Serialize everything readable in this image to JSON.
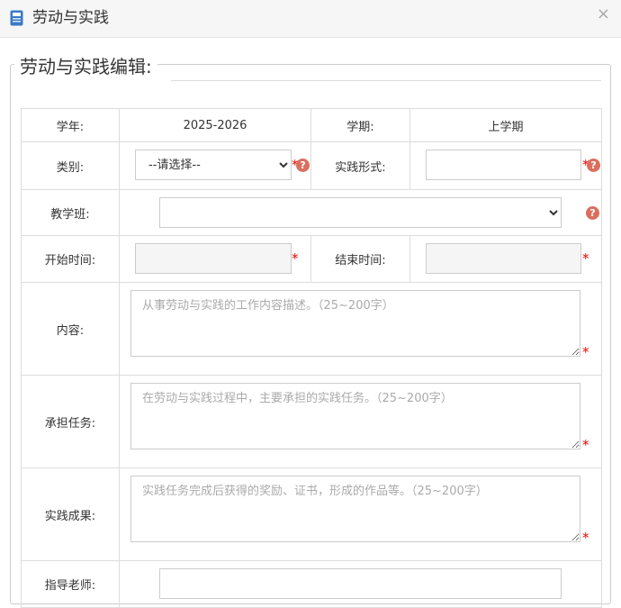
{
  "dialog": {
    "title": "劳动与实践",
    "close_symbol": "×",
    "icon": "document-icon"
  },
  "form": {
    "legend": "劳动与实践编辑:",
    "school_year_label": "学年:",
    "school_year_value": "2025-2026",
    "semester_label": "学期:",
    "semester_value": "上学期",
    "category_label": "类别:",
    "category_selected": "--请选择--",
    "practice_form_label": "实践形式:",
    "practice_form_value": "",
    "class_label": "教学班:",
    "class_selected": "",
    "start_time_label": "开始时间:",
    "start_time_value": "",
    "end_time_label": "结束时间:",
    "end_time_value": "",
    "content_label": "内容:",
    "content_placeholder": "从事劳动与实践的工作内容描述。（25~200字）",
    "task_label": "承担任务:",
    "task_placeholder": "在劳动与实践过程中，主要承担的实践任务。（25~200字）",
    "result_label": "实践成果:",
    "result_placeholder": "实践任务完成后获得的奖励、证书，形成的作品等。（25~200字）",
    "teacher_label": "指导老师:",
    "teacher_value": "",
    "required_mark": "*",
    "help_mark": "?"
  },
  "colors": {
    "required": "#e00000",
    "help_icon": "#d9705f",
    "border": "#dddddd"
  }
}
